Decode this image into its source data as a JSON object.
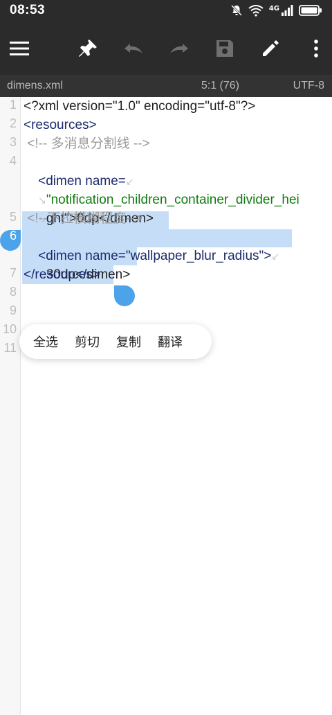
{
  "status_bar": {
    "time": "08:53",
    "network": "4G"
  },
  "toolbar": {
    "icons": [
      "menu-icon",
      "pin-icon",
      "undo-icon",
      "redo-icon",
      "save-icon",
      "edit-icon",
      "more-icon"
    ]
  },
  "file_bar": {
    "filename": "dimens.xml",
    "cursor_position": "5:1 (76)",
    "encoding": "UTF-8"
  },
  "editor": {
    "line_numbers": [
      "1",
      "2",
      "3",
      "4",
      "",
      "",
      "5",
      "6",
      "",
      "7",
      "8",
      "9",
      "10",
      "11"
    ],
    "lines": [
      "<?xml version=\"1.0\" encoding=\"utf-8\"?>",
      "<resources>",
      " <!-- 多消息分割线 -->",
      "<dimen name=",
      "\"notification_children_container_divider_hei",
      "ght\">0dp</dimen>",
      " <!--下拉模糊程度-->",
      "<dimen name=\"wallpaper_blur_radius\">",
      "30dp</dimen>",
      "</resources>"
    ]
  },
  "context_menu": {
    "items": [
      "全选",
      "剪切",
      "复制",
      "翻译"
    ]
  },
  "colors": {
    "toolbar_bg": "#2b2b2b",
    "selection": "#c6ddf8",
    "handle": "#4da3ea"
  }
}
